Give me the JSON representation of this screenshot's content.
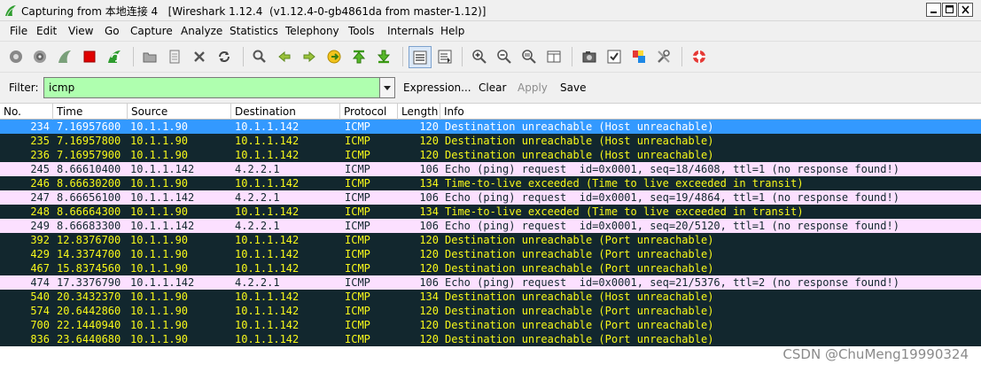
{
  "window": {
    "title": "Capturing from 本地连接 4   [Wireshark 1.12.4  (v1.12.4-0-gb4861da from master-1.12)]"
  },
  "menu": [
    {
      "label": "File"
    },
    {
      "label": "Edit"
    },
    {
      "label": "View"
    },
    {
      "label": "Go"
    },
    {
      "label": "Capture"
    },
    {
      "label": "Analyze"
    },
    {
      "label": "Statistics"
    },
    {
      "label": "Telephony"
    },
    {
      "label": "Tools"
    },
    {
      "label": "Internals"
    },
    {
      "label": "Help"
    }
  ],
  "filter": {
    "label": "Filter:",
    "value": "icmp",
    "expression_label": "Expression...",
    "clear_label": "Clear",
    "apply_label": "Apply",
    "save_label": "Save"
  },
  "columns": [
    "No.",
    "Time",
    "Source",
    "Destination",
    "Protocol",
    "Length",
    "Info"
  ],
  "colors": {
    "selected_bg": "#3399ff",
    "dark_bg": "#12272e",
    "dark_fg": "#f7f81a",
    "pink_bg": "#fce0ff",
    "filter_bg": "#afffaf"
  },
  "packets": [
    {
      "no": "234",
      "time": "7.16957600",
      "src": "10.1.1.90",
      "dst": "10.1.1.142",
      "proto": "ICMP",
      "len": "120",
      "info": "Destination unreachable (Host unreachable)",
      "style": "selected"
    },
    {
      "no": "235",
      "time": "7.16957800",
      "src": "10.1.1.90",
      "dst": "10.1.1.142",
      "proto": "ICMP",
      "len": "120",
      "info": "Destination unreachable (Host unreachable)",
      "style": "dark"
    },
    {
      "no": "236",
      "time": "7.16957900",
      "src": "10.1.1.90",
      "dst": "10.1.1.142",
      "proto": "ICMP",
      "len": "120",
      "info": "Destination unreachable (Host unreachable)",
      "style": "dark"
    },
    {
      "no": "245",
      "time": "8.66610400",
      "src": "10.1.1.142",
      "dst": "4.2.2.1",
      "proto": "ICMP",
      "len": "106",
      "info": "Echo (ping) request  id=0x0001, seq=18/4608, ttl=1 (no response found!)",
      "style": "pink"
    },
    {
      "no": "246",
      "time": "8.66630200",
      "src": "10.1.1.90",
      "dst": "10.1.1.142",
      "proto": "ICMP",
      "len": "134",
      "info": "Time-to-live exceeded (Time to live exceeded in transit)",
      "style": "dark"
    },
    {
      "no": "247",
      "time": "8.66656100",
      "src": "10.1.1.142",
      "dst": "4.2.2.1",
      "proto": "ICMP",
      "len": "106",
      "info": "Echo (ping) request  id=0x0001, seq=19/4864, ttl=1 (no response found!)",
      "style": "pink"
    },
    {
      "no": "248",
      "time": "8.66664300",
      "src": "10.1.1.90",
      "dst": "10.1.1.142",
      "proto": "ICMP",
      "len": "134",
      "info": "Time-to-live exceeded (Time to live exceeded in transit)",
      "style": "dark"
    },
    {
      "no": "249",
      "time": "8.66683300",
      "src": "10.1.1.142",
      "dst": "4.2.2.1",
      "proto": "ICMP",
      "len": "106",
      "info": "Echo (ping) request  id=0x0001, seq=20/5120, ttl=1 (no response found!)",
      "style": "pink"
    },
    {
      "no": "392",
      "time": "12.8376700",
      "src": "10.1.1.90",
      "dst": "10.1.1.142",
      "proto": "ICMP",
      "len": "120",
      "info": "Destination unreachable (Port unreachable)",
      "style": "dark"
    },
    {
      "no": "429",
      "time": "14.3374700",
      "src": "10.1.1.90",
      "dst": "10.1.1.142",
      "proto": "ICMP",
      "len": "120",
      "info": "Destination unreachable (Port unreachable)",
      "style": "dark"
    },
    {
      "no": "467",
      "time": "15.8374560",
      "src": "10.1.1.90",
      "dst": "10.1.1.142",
      "proto": "ICMP",
      "len": "120",
      "info": "Destination unreachable (Port unreachable)",
      "style": "dark"
    },
    {
      "no": "474",
      "time": "17.3376790",
      "src": "10.1.1.142",
      "dst": "4.2.2.1",
      "proto": "ICMP",
      "len": "106",
      "info": "Echo (ping) request  id=0x0001, seq=21/5376, ttl=2 (no response found!)",
      "style": "pink"
    },
    {
      "no": "540",
      "time": "20.3432370",
      "src": "10.1.1.90",
      "dst": "10.1.1.142",
      "proto": "ICMP",
      "len": "134",
      "info": "Destination unreachable (Host unreachable)",
      "style": "dark"
    },
    {
      "no": "574",
      "time": "20.6442860",
      "src": "10.1.1.90",
      "dst": "10.1.1.142",
      "proto": "ICMP",
      "len": "120",
      "info": "Destination unreachable (Port unreachable)",
      "style": "dark"
    },
    {
      "no": "700",
      "time": "22.1440940",
      "src": "10.1.1.90",
      "dst": "10.1.1.142",
      "proto": "ICMP",
      "len": "120",
      "info": "Destination unreachable (Port unreachable)",
      "style": "dark"
    },
    {
      "no": "836",
      "time": "23.6440680",
      "src": "10.1.1.90",
      "dst": "10.1.1.142",
      "proto": "ICMP",
      "len": "120",
      "info": "Destination unreachable (Port unreachable)",
      "style": "dark"
    }
  ],
  "watermark": "CSDN @ChuMeng19990324"
}
